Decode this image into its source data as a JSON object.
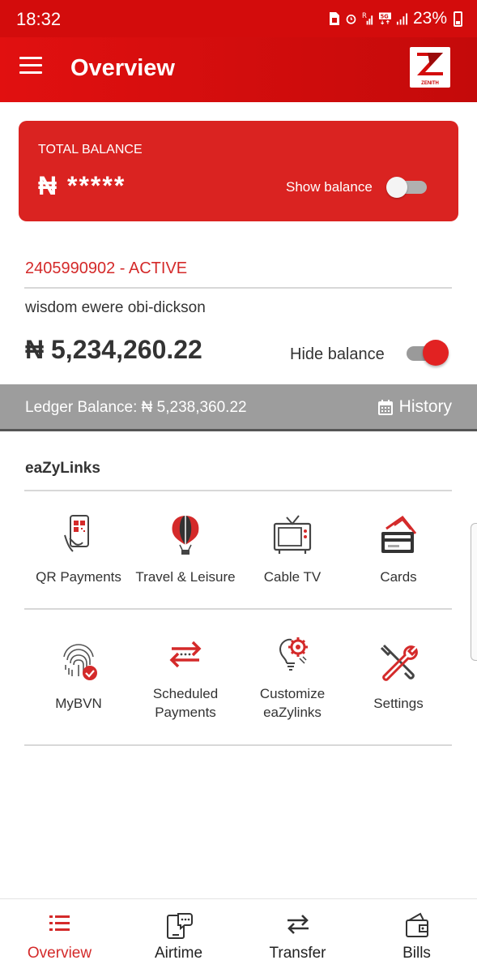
{
  "status_bar": {
    "time": "18:32",
    "network": "5G",
    "battery": "23%"
  },
  "app_bar": {
    "title": "Overview",
    "logo_text": "ZENITH"
  },
  "balance_card": {
    "label": "TOTAL BALANCE",
    "masked_value": "₦ *****",
    "toggle_label": "Show balance",
    "toggle_on": false
  },
  "account": {
    "number_status": "2405990902  - ACTIVE",
    "name": "wisdom ewere obi-dickson",
    "balance": "₦ 5,234,260.22",
    "toggle_label": "Hide balance",
    "toggle_on": true
  },
  "ledger": {
    "text": "Ledger Balance: ₦ 5,238,360.22",
    "history_label": "History"
  },
  "eazylinks": {
    "title": "eaZyLinks",
    "row1": [
      {
        "label": "QR Payments",
        "icon": "qr-phone-icon"
      },
      {
        "label": "Travel & Leisure",
        "icon": "hot-air-balloon-icon"
      },
      {
        "label": "Cable TV",
        "icon": "tv-icon"
      },
      {
        "label": "Cards",
        "icon": "cards-icon"
      }
    ],
    "row2": [
      {
        "label": "MyBVN",
        "icon": "fingerprint-icon"
      },
      {
        "label1": "Scheduled",
        "label2": "Payments",
        "icon": "scheduled-arrows-icon"
      },
      {
        "label1": "Customize",
        "label2": "eaZylinks",
        "icon": "bulb-gear-icon"
      },
      {
        "label": "Settings",
        "icon": "tools-icon"
      }
    ]
  },
  "bottom_nav": [
    {
      "label": "Overview",
      "icon": "list-icon",
      "active": true
    },
    {
      "label": "Airtime",
      "icon": "phone-chat-icon",
      "active": false
    },
    {
      "label": "Transfer",
      "icon": "swap-arrows-icon",
      "active": false
    },
    {
      "label": "Bills",
      "icon": "wallet-icon",
      "active": false
    }
  ],
  "colors": {
    "brand_red": "#da2321",
    "status_red": "#d30c0c",
    "ledger_gray": "#9d9d9d",
    "text_dark": "#333333"
  }
}
